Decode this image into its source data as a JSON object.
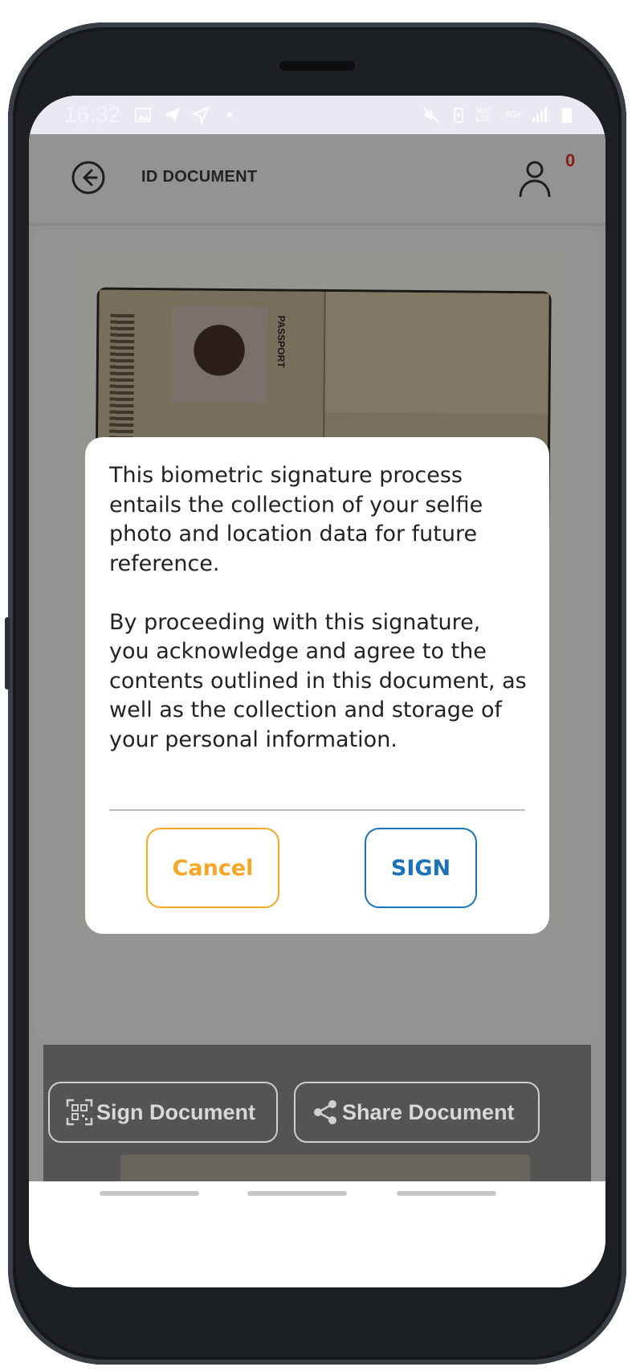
{
  "status_bar": {
    "time": "16:32",
    "left_icons": [
      "image-icon",
      "send-icon",
      "navigation-icon",
      "dot-icon"
    ],
    "right_icons": [
      "mute-icon",
      "battery-saver-icon",
      "volte-icon",
      "network-4g-icon",
      "signal-icon",
      "battery-icon"
    ],
    "volte_label": "Vo)) LTE",
    "network_label": "4G+"
  },
  "header": {
    "title": "ID DOCUMENT",
    "back_icon": "back-arrow-icon",
    "profile_icon": "user-icon",
    "notification_count": "0"
  },
  "document": {
    "passport_label": "PASSPORT"
  },
  "dialog": {
    "message": "This biometric signature process entails the collection of your selfie photo and location data for future reference.\n\nBy proceeding with this signature, you acknowledge and agree to the contents outlined in this document, as well as the collection and storage of your personal information.",
    "cancel_label": "Cancel",
    "sign_label": "SIGN"
  },
  "bottom_actions": {
    "sign_document_label": "Sign Document",
    "share_document_label": "Share Document",
    "sign_icon": "qr-code-icon",
    "share_icon": "share-icon"
  },
  "colors": {
    "cancel_accent": "#f5a623",
    "sign_accent": "#1a73b8",
    "badge": "#e3322a"
  }
}
